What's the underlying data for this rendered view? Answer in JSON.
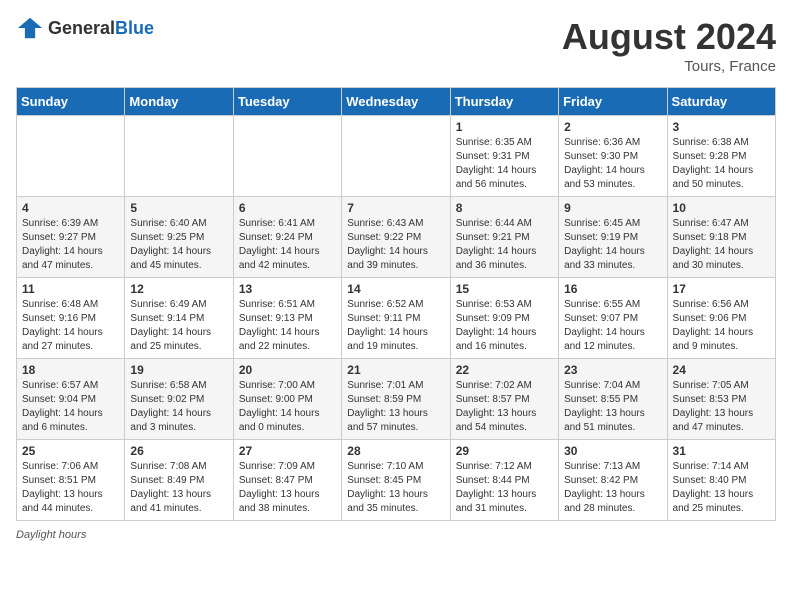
{
  "header": {
    "logo_general": "General",
    "logo_blue": "Blue",
    "month_year": "August 2024",
    "location": "Tours, France"
  },
  "calendar": {
    "days_of_week": [
      "Sunday",
      "Monday",
      "Tuesday",
      "Wednesday",
      "Thursday",
      "Friday",
      "Saturday"
    ],
    "weeks": [
      [
        {
          "day": "",
          "info": ""
        },
        {
          "day": "",
          "info": ""
        },
        {
          "day": "",
          "info": ""
        },
        {
          "day": "",
          "info": ""
        },
        {
          "day": "1",
          "info": "Sunrise: 6:35 AM\nSunset: 9:31 PM\nDaylight: 14 hours and 56 minutes."
        },
        {
          "day": "2",
          "info": "Sunrise: 6:36 AM\nSunset: 9:30 PM\nDaylight: 14 hours and 53 minutes."
        },
        {
          "day": "3",
          "info": "Sunrise: 6:38 AM\nSunset: 9:28 PM\nDaylight: 14 hours and 50 minutes."
        }
      ],
      [
        {
          "day": "4",
          "info": "Sunrise: 6:39 AM\nSunset: 9:27 PM\nDaylight: 14 hours and 47 minutes."
        },
        {
          "day": "5",
          "info": "Sunrise: 6:40 AM\nSunset: 9:25 PM\nDaylight: 14 hours and 45 minutes."
        },
        {
          "day": "6",
          "info": "Sunrise: 6:41 AM\nSunset: 9:24 PM\nDaylight: 14 hours and 42 minutes."
        },
        {
          "day": "7",
          "info": "Sunrise: 6:43 AM\nSunset: 9:22 PM\nDaylight: 14 hours and 39 minutes."
        },
        {
          "day": "8",
          "info": "Sunrise: 6:44 AM\nSunset: 9:21 PM\nDaylight: 14 hours and 36 minutes."
        },
        {
          "day": "9",
          "info": "Sunrise: 6:45 AM\nSunset: 9:19 PM\nDaylight: 14 hours and 33 minutes."
        },
        {
          "day": "10",
          "info": "Sunrise: 6:47 AM\nSunset: 9:18 PM\nDaylight: 14 hours and 30 minutes."
        }
      ],
      [
        {
          "day": "11",
          "info": "Sunrise: 6:48 AM\nSunset: 9:16 PM\nDaylight: 14 hours and 27 minutes."
        },
        {
          "day": "12",
          "info": "Sunrise: 6:49 AM\nSunset: 9:14 PM\nDaylight: 14 hours and 25 minutes."
        },
        {
          "day": "13",
          "info": "Sunrise: 6:51 AM\nSunset: 9:13 PM\nDaylight: 14 hours and 22 minutes."
        },
        {
          "day": "14",
          "info": "Sunrise: 6:52 AM\nSunset: 9:11 PM\nDaylight: 14 hours and 19 minutes."
        },
        {
          "day": "15",
          "info": "Sunrise: 6:53 AM\nSunset: 9:09 PM\nDaylight: 14 hours and 16 minutes."
        },
        {
          "day": "16",
          "info": "Sunrise: 6:55 AM\nSunset: 9:07 PM\nDaylight: 14 hours and 12 minutes."
        },
        {
          "day": "17",
          "info": "Sunrise: 6:56 AM\nSunset: 9:06 PM\nDaylight: 14 hours and 9 minutes."
        }
      ],
      [
        {
          "day": "18",
          "info": "Sunrise: 6:57 AM\nSunset: 9:04 PM\nDaylight: 14 hours and 6 minutes."
        },
        {
          "day": "19",
          "info": "Sunrise: 6:58 AM\nSunset: 9:02 PM\nDaylight: 14 hours and 3 minutes."
        },
        {
          "day": "20",
          "info": "Sunrise: 7:00 AM\nSunset: 9:00 PM\nDaylight: 14 hours and 0 minutes."
        },
        {
          "day": "21",
          "info": "Sunrise: 7:01 AM\nSunset: 8:59 PM\nDaylight: 13 hours and 57 minutes."
        },
        {
          "day": "22",
          "info": "Sunrise: 7:02 AM\nSunset: 8:57 PM\nDaylight: 13 hours and 54 minutes."
        },
        {
          "day": "23",
          "info": "Sunrise: 7:04 AM\nSunset: 8:55 PM\nDaylight: 13 hours and 51 minutes."
        },
        {
          "day": "24",
          "info": "Sunrise: 7:05 AM\nSunset: 8:53 PM\nDaylight: 13 hours and 47 minutes."
        }
      ],
      [
        {
          "day": "25",
          "info": "Sunrise: 7:06 AM\nSunset: 8:51 PM\nDaylight: 13 hours and 44 minutes."
        },
        {
          "day": "26",
          "info": "Sunrise: 7:08 AM\nSunset: 8:49 PM\nDaylight: 13 hours and 41 minutes."
        },
        {
          "day": "27",
          "info": "Sunrise: 7:09 AM\nSunset: 8:47 PM\nDaylight: 13 hours and 38 minutes."
        },
        {
          "day": "28",
          "info": "Sunrise: 7:10 AM\nSunset: 8:45 PM\nDaylight: 13 hours and 35 minutes."
        },
        {
          "day": "29",
          "info": "Sunrise: 7:12 AM\nSunset: 8:44 PM\nDaylight: 13 hours and 31 minutes."
        },
        {
          "day": "30",
          "info": "Sunrise: 7:13 AM\nSunset: 8:42 PM\nDaylight: 13 hours and 28 minutes."
        },
        {
          "day": "31",
          "info": "Sunrise: 7:14 AM\nSunset: 8:40 PM\nDaylight: 13 hours and 25 minutes."
        }
      ]
    ]
  },
  "footer": {
    "label": "Daylight hours"
  }
}
